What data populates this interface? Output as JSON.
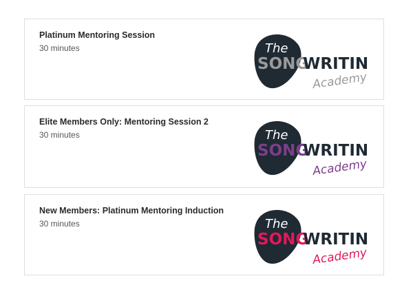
{
  "sessions": [
    {
      "title": "Platinum Mentoring Session",
      "duration": "30 minutes",
      "logo": {
        "the": "The",
        "song": "SONG",
        "writing": "WRITING",
        "academy": "Academy",
        "accent_color": "#9a9a9a",
        "dark_color": "#1f2a33"
      }
    },
    {
      "title": "Elite Members Only: Mentoring Session 2",
      "duration": "30 minutes",
      "logo": {
        "the": "The",
        "song": "SONG",
        "writing": "WRITING",
        "academy": "Academy",
        "accent_color": "#7b3f8c",
        "dark_color": "#1f2a33"
      }
    },
    {
      "title": "New Members: Platinum Mentoring Induction",
      "duration": "30 minutes",
      "logo": {
        "the": "The",
        "song": "SONG",
        "writing": "WRITING",
        "academy": "Academy",
        "accent_color": "#e0195a",
        "dark_color": "#1f2a33"
      }
    }
  ]
}
